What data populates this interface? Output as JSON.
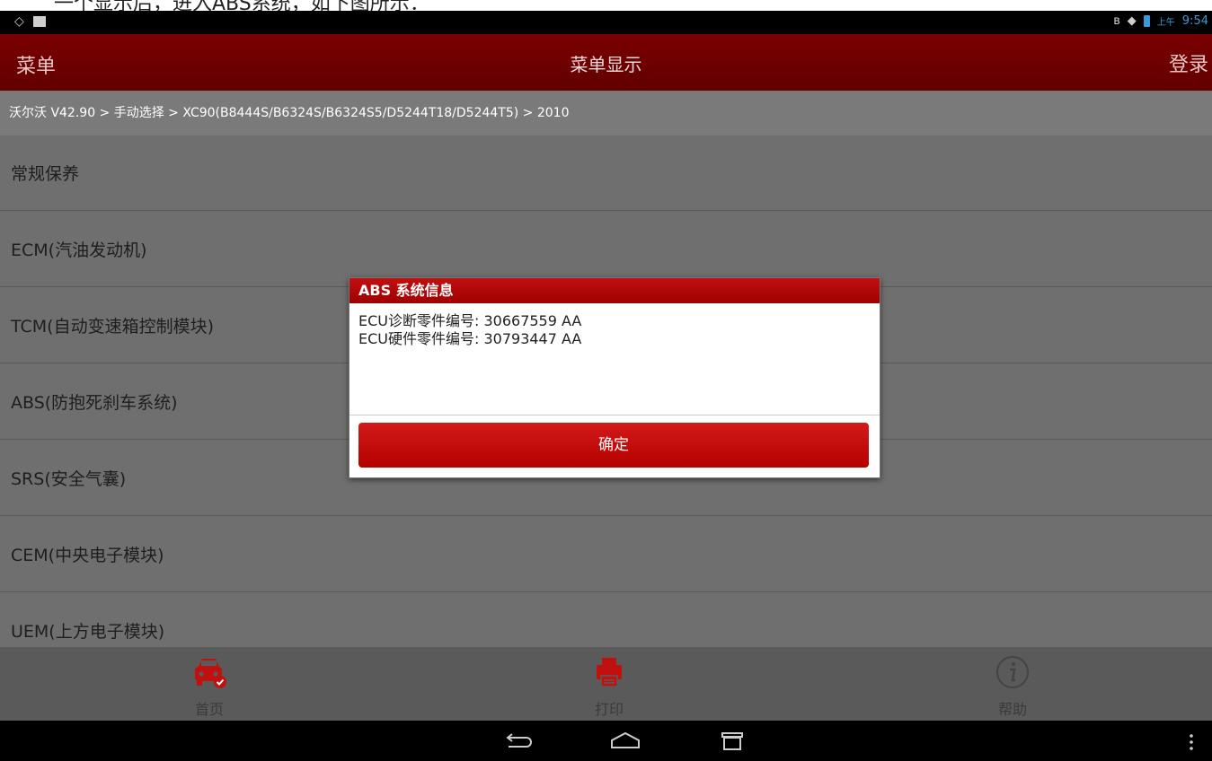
{
  "caption": {
    "text": "一个显示后，进入ABS系统，如下图所示："
  },
  "statusbar": {
    "clock": "9:54",
    "ampm": "上午"
  },
  "appbar": {
    "menu": "菜单",
    "title": "菜单显示",
    "login": "登录"
  },
  "breadcrumb": "沃尔沃 V42.90 > 手动选择 > XC90(B8444S/B6324S/B6324S5/D5244T18/D5244T5) > 2010",
  "menu_items": [
    "常规保养",
    "ECM(汽油发动机)",
    "TCM(自动变速箱控制模块)",
    "ABS(防抱死刹车系统)",
    "SRS(安全气囊)",
    "CEM(中央电子模块)",
    "UEM(上方电子模块)"
  ],
  "bottom_nav": {
    "home": "首页",
    "print": "打印",
    "help": "帮助"
  },
  "dialog": {
    "title": "ABS 系统信息",
    "line1": "ECU诊断零件编号: 30667559 AA",
    "line2": "ECU硬件零件编号: 30793447 AA",
    "ok": "确定"
  },
  "colors": {
    "accent": "#7a0000",
    "dialog_red": "#c01010",
    "clock_blue": "#3a9ad9"
  }
}
